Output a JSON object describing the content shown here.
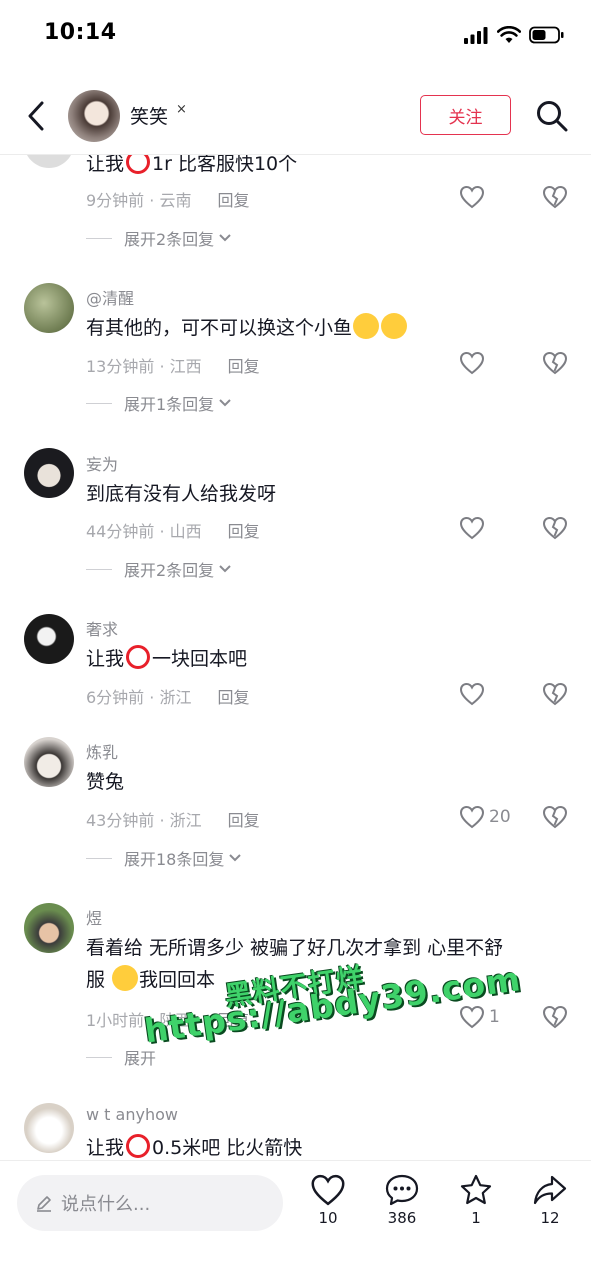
{
  "status_bar": {
    "time": "10:14"
  },
  "header": {
    "name": "笑笑",
    "close_mark": "×",
    "follow_label": "关注"
  },
  "comments": [
    {
      "user": "",
      "segments": [
        "让我",
        "1r  比客服快10个"
      ],
      "meta": "9分钟前 · 云南",
      "reply": "回复",
      "likes": "",
      "expand": "展开2条回复"
    },
    {
      "user": "@清醒",
      "segments": [
        "有其他的，可不可以换这个小鱼"
      ],
      "meta": "13分钟前 · 江西",
      "reply": "回复",
      "likes": "",
      "expand": "展开1条回复"
    },
    {
      "user": "妄为",
      "segments": [
        "到底有没有人给我发呀"
      ],
      "meta": "44分钟前 · 山西",
      "reply": "回复",
      "likes": "",
      "expand": "展开2条回复"
    },
    {
      "user": "奢求",
      "segments": [
        "让我",
        "一块回本吧"
      ],
      "meta": "6分钟前 · 浙江",
      "reply": "回复",
      "likes": "",
      "expand": ""
    },
    {
      "user": "炼乳",
      "segments": [
        "赞兔"
      ],
      "meta": "43分钟前 · 浙江",
      "reply": "回复",
      "likes": "20",
      "expand": "展开18条回复"
    },
    {
      "user": "煜",
      "segments": [
        "看着给  无所谓多少  被骗了好几次才拿到  心里不舒",
        "服 ",
        "我回回本"
      ],
      "meta": "1小时前 · 陕西",
      "reply": "回复",
      "likes": "1",
      "expand": "展开"
    },
    {
      "user": "w t anyhow",
      "segments": [
        "让我",
        "0.5米吧 比火箭快"
      ],
      "meta": "",
      "reply": "",
      "likes": "",
      "expand": ""
    }
  ],
  "watermark": {
    "line1": "黑料不打烊",
    "line2": "https://abdy39.com"
  },
  "bottom_bar": {
    "input_placeholder": "说点什么...",
    "like_count": "10",
    "comment_count": "386",
    "favorite_count": "1",
    "share_count": "12"
  },
  "colors": {
    "accent": "#e4334f",
    "circle_emoji": "#e8202a",
    "watermark": "#3fd26a"
  }
}
